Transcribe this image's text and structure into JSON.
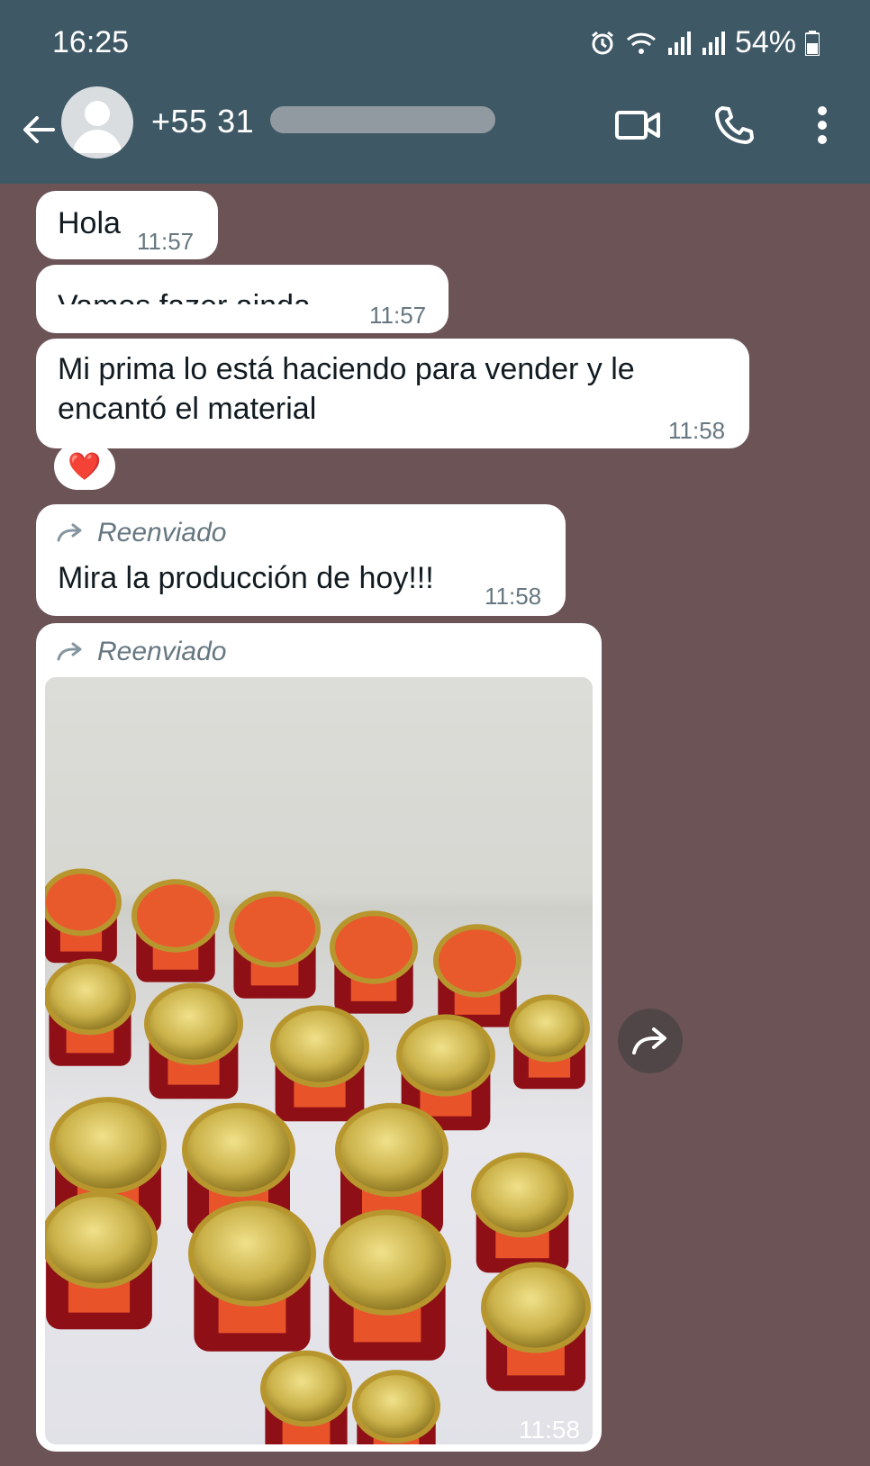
{
  "status_bar": {
    "time": "16:25",
    "battery": "54%",
    "icons": [
      "alarm-icon",
      "wifi-icon",
      "signal-icon",
      "signal-icon",
      "battery-icon"
    ]
  },
  "header": {
    "contact": "+55 31",
    "icons": [
      "back-arrow-icon",
      "avatar-icon",
      "video-call-icon",
      "phone-icon",
      "more-vert-icon"
    ]
  },
  "messages": [
    {
      "text": "Hola",
      "time": "11:57"
    },
    {
      "text": "Vamos fazer ainda",
      "time": "11:57"
    },
    {
      "text": "Mi prima lo está haciendo para vender y le encantó el material",
      "time": "11:58",
      "reaction": "❤️"
    },
    {
      "forwarded_label": "Reenviado",
      "text": "Mira la producción de hoy!!!",
      "time": "11:58"
    },
    {
      "forwarded_label": "Reenviado",
      "image": "photo of jam jars with gold lids",
      "time": "11:58"
    }
  ],
  "colors": {
    "header": "#3f5865",
    "wallpaper": "#6b5356",
    "bubble": "#ffffff",
    "meta": "#667781"
  }
}
